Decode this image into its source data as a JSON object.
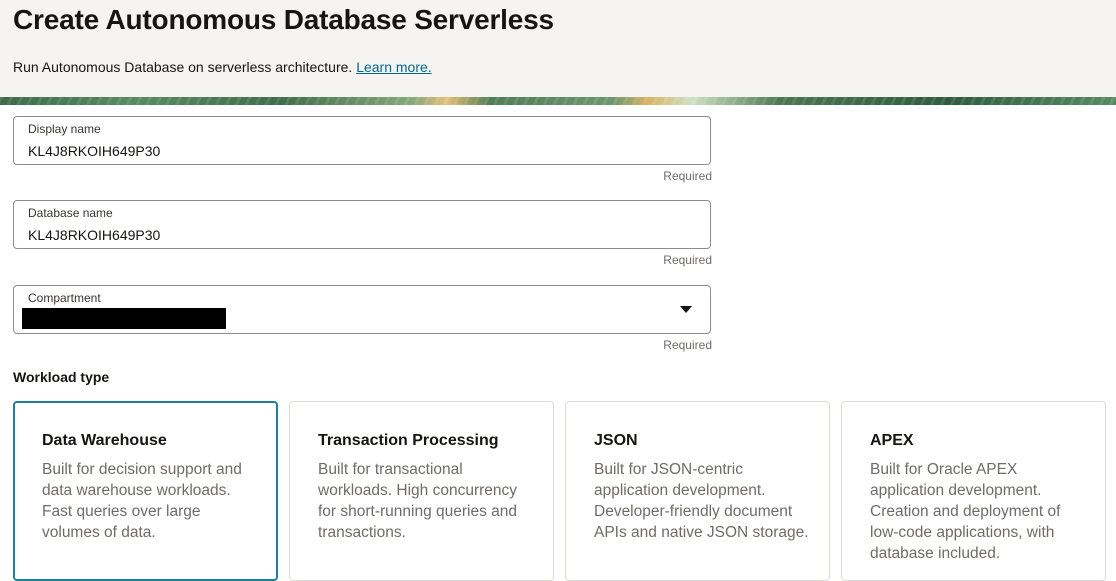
{
  "header": {
    "title": "Create Autonomous Database Serverless",
    "subtitle": "Run Autonomous Database on serverless architecture.",
    "learn_more": "Learn more."
  },
  "form": {
    "display_name": {
      "label": "Display name",
      "value": "KL4J8RKOIH649P30",
      "hint": "Required"
    },
    "database_name": {
      "label": "Database name",
      "value": "KL4J8RKOIH649P30",
      "hint": "Required"
    },
    "compartment": {
      "label": "Compartment",
      "value": "",
      "hint": "Required",
      "redacted": true
    }
  },
  "workload": {
    "label": "Workload type",
    "options": [
      {
        "title": "Data Warehouse",
        "description": "Built for decision support and data warehouse workloads. Fast queries over large volumes of data.",
        "selected": true
      },
      {
        "title": "Transaction Processing",
        "description": "Built for transactional workloads. High concurrency for short-running queries and transactions.",
        "selected": false
      },
      {
        "title": "JSON",
        "description": "Built for JSON-centric application development. Developer-friendly document APIs and native JSON storage.",
        "selected": false
      },
      {
        "title": "APEX",
        "description": "Built for Oracle APEX application development. Creation and deployment of low-code applications, with database included.",
        "selected": false
      }
    ]
  },
  "colors": {
    "link": "#00688c",
    "selected_border": "#227e9e",
    "header_bg": "#f5f4f2"
  }
}
